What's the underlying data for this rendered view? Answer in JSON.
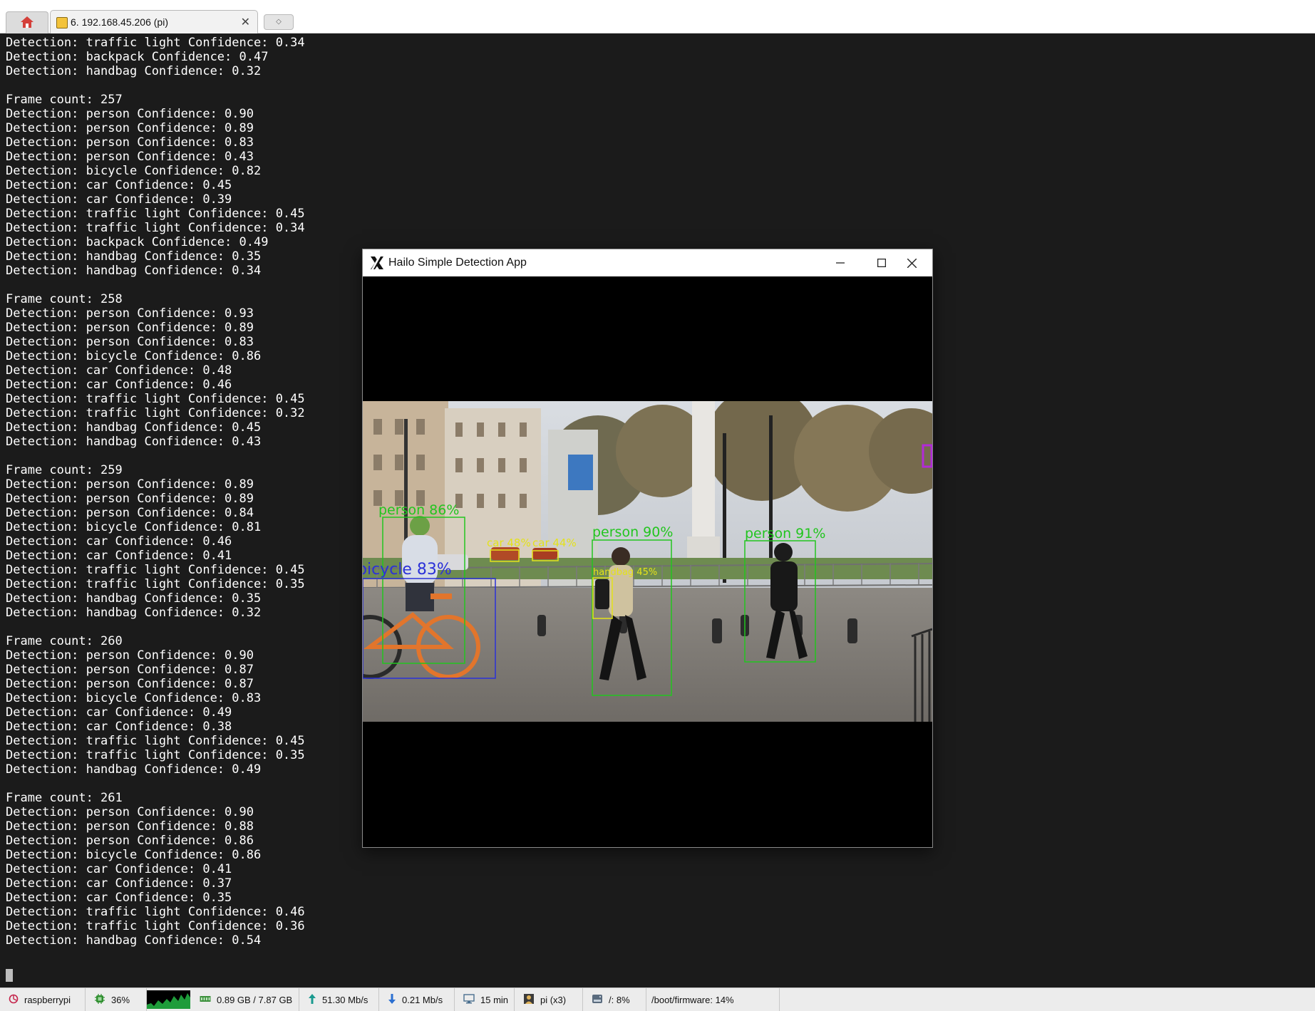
{
  "tabs": {
    "home_icon": "home-icon",
    "session_tab_label": "6. 192.168.45.206 (pi)",
    "session_tab_icon": "ssh-session-icon",
    "close_icon": "close-icon",
    "new_tab_icon": "new-tab-icon"
  },
  "terminal": {
    "lines": [
      "Detection: traffic light Confidence: 0.34",
      "Detection: backpack Confidence: 0.47",
      "Detection: handbag Confidence: 0.32",
      "",
      "Frame count: 257",
      "Detection: person Confidence: 0.90",
      "Detection: person Confidence: 0.89",
      "Detection: person Confidence: 0.83",
      "Detection: person Confidence: 0.43",
      "Detection: bicycle Confidence: 0.82",
      "Detection: car Confidence: 0.45",
      "Detection: car Confidence: 0.39",
      "Detection: traffic light Confidence: 0.45",
      "Detection: traffic light Confidence: 0.34",
      "Detection: backpack Confidence: 0.49",
      "Detection: handbag Confidence: 0.35",
      "Detection: handbag Confidence: 0.34",
      "",
      "Frame count: 258",
      "Detection: person Confidence: 0.93",
      "Detection: person Confidence: 0.89",
      "Detection: person Confidence: 0.83",
      "Detection: bicycle Confidence: 0.86",
      "Detection: car Confidence: 0.48",
      "Detection: car Confidence: 0.46",
      "Detection: traffic light Confidence: 0.45",
      "Detection: traffic light Confidence: 0.32",
      "Detection: handbag Confidence: 0.45",
      "Detection: handbag Confidence: 0.43",
      "",
      "Frame count: 259",
      "Detection: person Confidence: 0.89",
      "Detection: person Confidence: 0.89",
      "Detection: person Confidence: 0.84",
      "Detection: bicycle Confidence: 0.81",
      "Detection: car Confidence: 0.46",
      "Detection: car Confidence: 0.41",
      "Detection: traffic light Confidence: 0.45",
      "Detection: traffic light Confidence: 0.35",
      "Detection: handbag Confidence: 0.35",
      "Detection: handbag Confidence: 0.32",
      "",
      "Frame count: 260",
      "Detection: person Confidence: 0.90",
      "Detection: person Confidence: 0.87",
      "Detection: person Confidence: 0.87",
      "Detection: bicycle Confidence: 0.83",
      "Detection: car Confidence: 0.49",
      "Detection: car Confidence: 0.38",
      "Detection: traffic light Confidence: 0.45",
      "Detection: traffic light Confidence: 0.35",
      "Detection: handbag Confidence: 0.49",
      "",
      "Frame count: 261",
      "Detection: person Confidence: 0.90",
      "Detection: person Confidence: 0.88",
      "Detection: person Confidence: 0.86",
      "Detection: bicycle Confidence: 0.86",
      "Detection: car Confidence: 0.41",
      "Detection: car Confidence: 0.37",
      "Detection: car Confidence: 0.35",
      "Detection: traffic light Confidence: 0.46",
      "Detection: traffic light Confidence: 0.36",
      "Detection: handbag Confidence: 0.54"
    ]
  },
  "app_window": {
    "title": "Hailo Simple Detection App",
    "app_icon": "x11-app-icon",
    "minimize_icon": "minimize-icon",
    "maximize_icon": "maximize-icon",
    "close_icon": "close-icon",
    "detections": [
      {
        "label": "person 90%",
        "color": "#22c51f"
      },
      {
        "label": "person 91%",
        "color": "#22c51f"
      },
      {
        "label": "person 86%",
        "color": "#22c51f"
      },
      {
        "label": "bicycle 83%",
        "color": "#2b31d8"
      },
      {
        "label": "car 48%",
        "color": "#e4e21a"
      },
      {
        "label": "car 44%",
        "color": "#e4e21a"
      },
      {
        "label": "handbag 45%",
        "color": "#e4e21a"
      }
    ]
  },
  "statusbar": {
    "host": "raspberrypi",
    "host_icon": "raspberry-icon",
    "cpu": "36%",
    "cpu_icon": "cpu-chip-icon",
    "memory": "0.89 GB / 7.87 GB",
    "memory_icon": "memory-icon",
    "upload": "51.30 Mb/s",
    "upload_icon": "upload-arrow-icon",
    "download": "0.21 Mb/s",
    "download_icon": "download-arrow-icon",
    "uptime": "15 min",
    "uptime_icon": "monitor-icon",
    "users": "pi (x3)",
    "users_icon": "user-icon",
    "disk_root": "/: 8%",
    "disk_icon": "disk-icon",
    "disk_boot": "/boot/firmware: 14%"
  }
}
